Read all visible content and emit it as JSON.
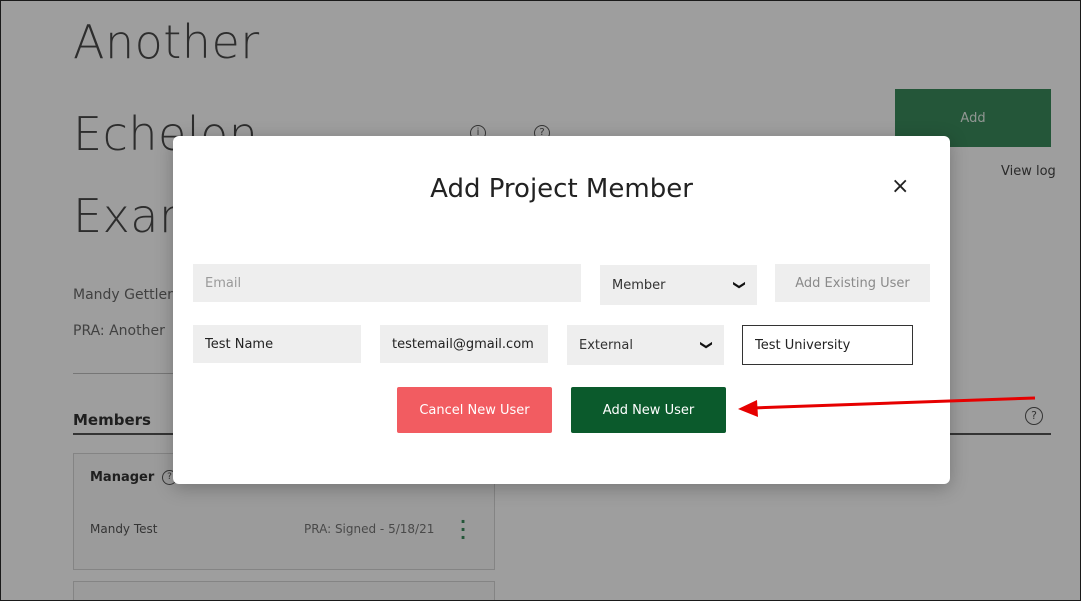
{
  "background": {
    "title_lines": [
      "Another",
      "Echelon",
      "Exan"
    ],
    "owner_text": "Mandy Gettler",
    "pra_text": "PRA: Another",
    "add_button_label": "Add",
    "view_log_label": "View log",
    "members_heading": "Members",
    "manager_label": "Manager",
    "member_row": {
      "name": "Mandy Test",
      "pra_status": "PRA: Signed - 5/18/21"
    }
  },
  "modal": {
    "title": "Add Project Member",
    "close_glyph": "×",
    "email_placeholder": "Email",
    "role_select": {
      "selected": "Member"
    },
    "add_existing_label": "Add Existing User",
    "new_user": {
      "name_value": "Test Name",
      "email_value": "testemail@gmail.com",
      "affiliation_select": {
        "selected": "External"
      },
      "institution_value": "Test University"
    },
    "cancel_label": "Cancel New User",
    "add_new_label": "Add New User"
  },
  "colors": {
    "cancel": "#f25c61",
    "add_new": "#0b5a2c",
    "annotation_arrow": "#e60000",
    "brand_green": "#3a8c5c"
  },
  "icons": {
    "help": "question-circle-icon",
    "info": "info-circle-icon",
    "select_chevron": "chevron-down-icon",
    "close": "close-icon",
    "kebab": "kebab-menu-icon"
  }
}
